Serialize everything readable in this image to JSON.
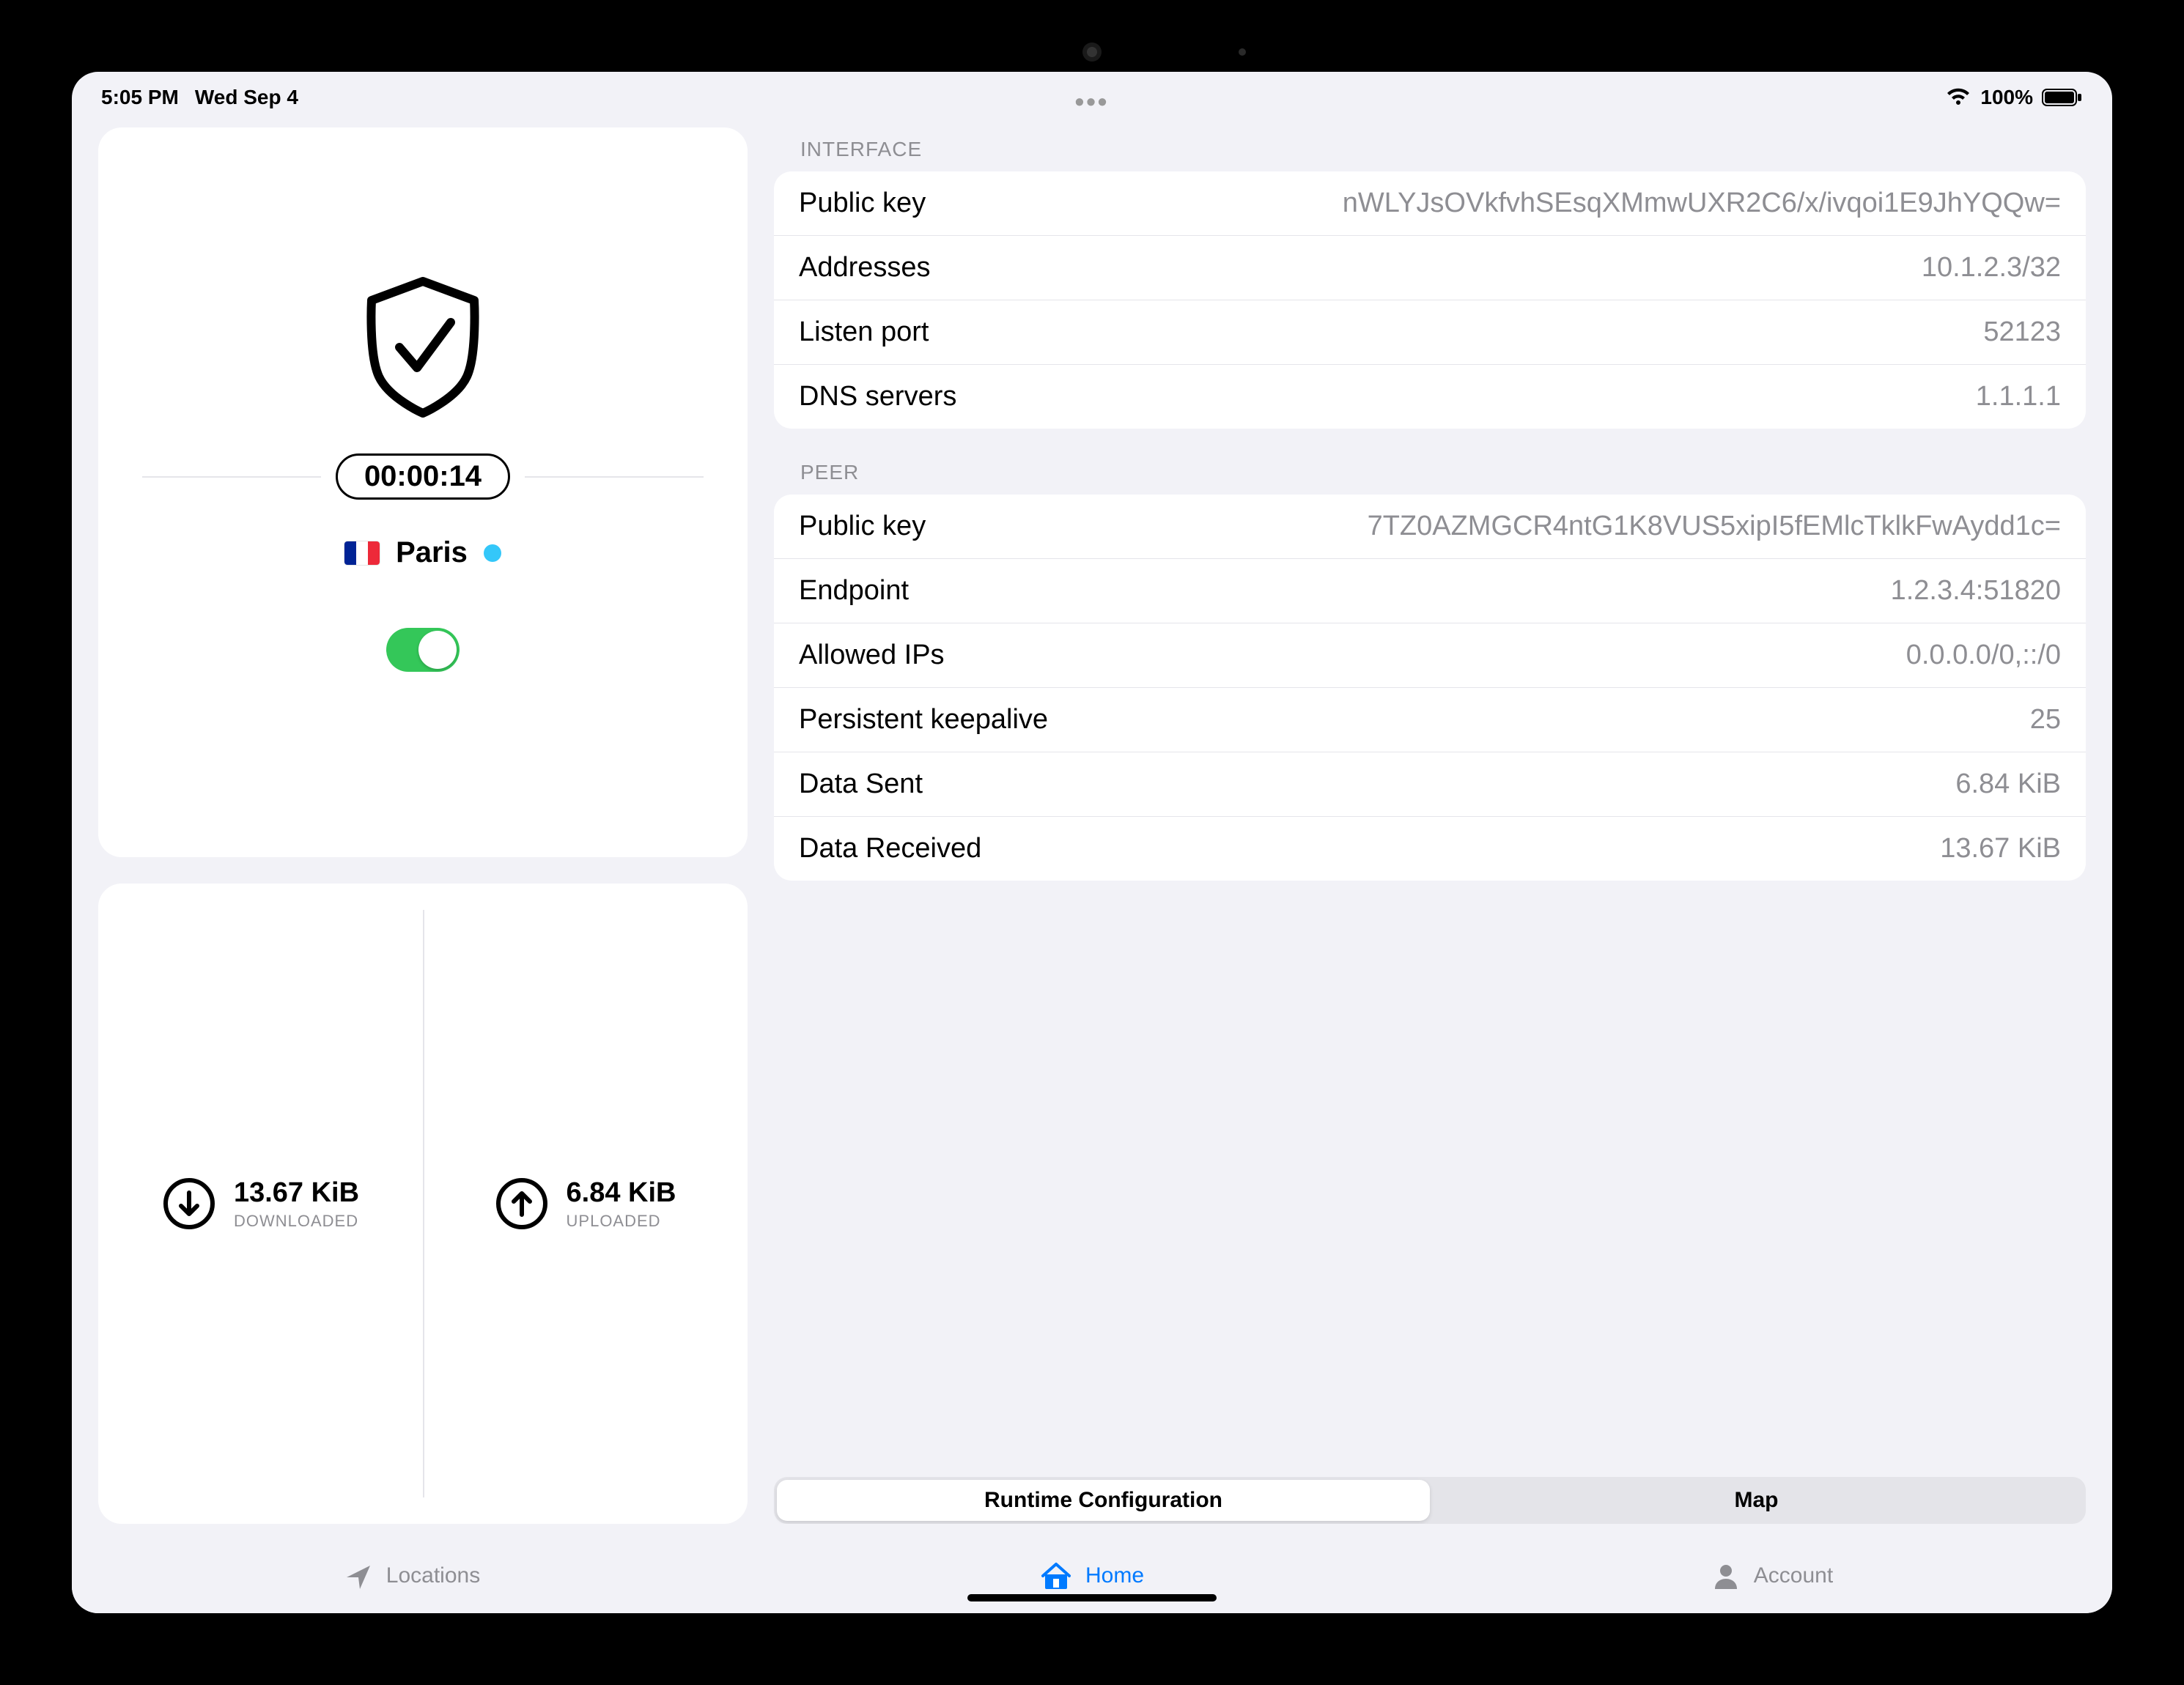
{
  "status": {
    "time": "5:05 PM",
    "date": "Wed Sep 4",
    "battery": "100%"
  },
  "connection": {
    "duration": "00:00:14",
    "location": "Paris",
    "enabled": true
  },
  "stats": {
    "downloaded_value": "13.67 KiB",
    "downloaded_label": "DOWNLOADED",
    "uploaded_value": "6.84 KiB",
    "uploaded_label": "UPLOADED"
  },
  "sections": {
    "interface_header": "Interface",
    "peer_header": "Peer"
  },
  "interface": [
    {
      "label": "Public key",
      "value": "nWLYJsOVkfvhSEsqXMmwUXR2C6/x/ivqoi1E9JhYQQw="
    },
    {
      "label": "Addresses",
      "value": "10.1.2.3/32"
    },
    {
      "label": "Listen port",
      "value": "52123"
    },
    {
      "label": "DNS servers",
      "value": "1.1.1.1"
    }
  ],
  "peer": [
    {
      "label": "Public key",
      "value": "7TZ0AZMGCR4ntG1K8VUS5xipI5fEMlcTklkFwAydd1c="
    },
    {
      "label": "Endpoint",
      "value": "1.2.3.4:51820"
    },
    {
      "label": "Allowed IPs",
      "value": "0.0.0.0/0,::/0"
    },
    {
      "label": "Persistent keepalive",
      "value": "25"
    },
    {
      "label": "Data Sent",
      "value": "6.84 KiB"
    },
    {
      "label": "Data Received",
      "value": "13.67 KiB"
    }
  ],
  "segmented": {
    "runtime": "Runtime Configuration",
    "map": "Map"
  },
  "tabs": {
    "locations": "Locations",
    "home": "Home",
    "account": "Account"
  }
}
